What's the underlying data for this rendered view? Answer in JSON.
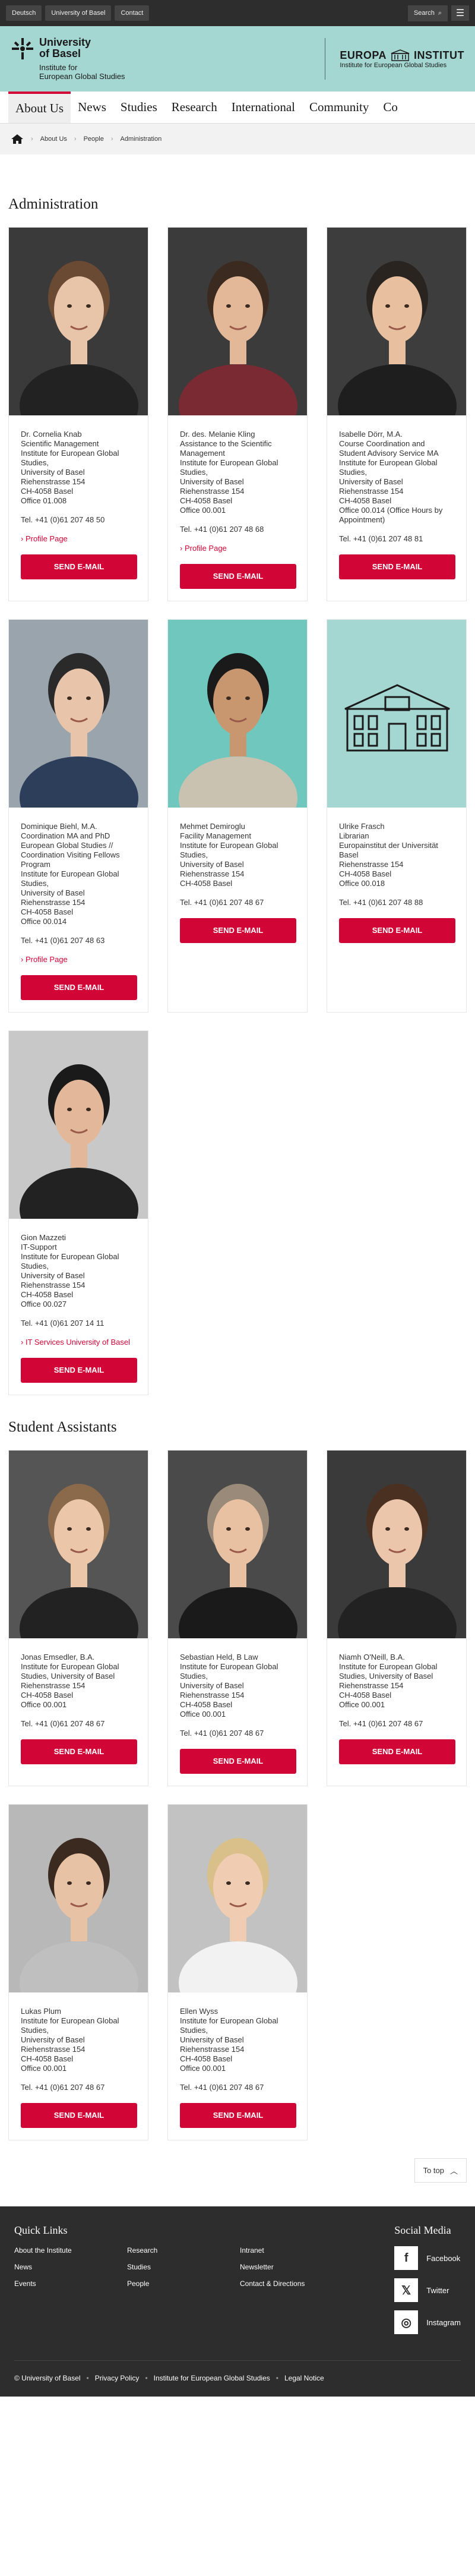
{
  "topbar": {
    "lang1": "Deutsch",
    "lang2": "University of Basel",
    "lang3": "Contact",
    "search": "Search"
  },
  "brand": {
    "uni_name_1": "University",
    "uni_name_2": "of Basel",
    "institute_1": "Institute for",
    "institute_2": "European Global Studies",
    "europa": "EUROPA",
    "institut": "INSTITUT",
    "europa_sub": "Institute for European Global Studies"
  },
  "nav": {
    "items": [
      "About Us",
      "News",
      "Studies",
      "Research",
      "International",
      "Community",
      "Co"
    ]
  },
  "breadcrumb": {
    "items": [
      "About Us",
      "People",
      "Administration"
    ]
  },
  "page_title": "Administration",
  "section_title": "Student Assistants",
  "send_label": "SEND E-MAIL",
  "administration": [
    {
      "lines": [
        "Dr. Cornelia Knab",
        "Scientific Management",
        "Institute for European Global",
        "Studies,",
        "University of Basel",
        "Riehenstrasse 154",
        "CH-4058 Basel",
        "Office 01.008"
      ],
      "tel": "Tel. +41 (0)61 207 48 50",
      "link": "Profile Page"
    },
    {
      "lines": [
        "Dr. des. Melanie Kling",
        "Assistance to the Scientific",
        "Management",
        "Institute for European Global",
        "Studies,",
        "University of Basel",
        "Riehenstrasse 154",
        "CH-4058 Basel",
        "Office 00.001"
      ],
      "tel": "Tel. +41 (0)61 207 48 68",
      "link": "Profile Page"
    },
    {
      "lines": [
        "Isabelle Dörr, M.A.",
        "Course Coordination and",
        "Student Advisory Service MA",
        "Institute for European Global",
        "Studies,",
        "University of Basel",
        "Riehenstrasse 154",
        "CH-4058 Basel",
        "Office 00.014 (Office Hours by",
        "Appointment)"
      ],
      "tel": "Tel. +41 (0)61 207 48 81",
      "link": ""
    },
    {
      "lines": [
        "Dominique Biehl, M.A.",
        "Coordination MA and PhD",
        "European Global Studies //",
        "Coordination Visiting Fellows",
        "Program",
        "Institute for European Global",
        "Studies,",
        "University of Basel",
        "Riehenstrasse 154",
        "CH-4058 Basel",
        "Office 00.014"
      ],
      "tel": "Tel. +41 (0)61 207 48 63",
      "link": "Profile Page"
    },
    {
      "lines": [
        "Mehmet Demiroglu",
        "Facility Management",
        "Institute for European Global",
        "Studies,",
        "University of Basel",
        "Riehenstrasse 154",
        "CH-4058 Basel"
      ],
      "tel": "Tel. +41 (0)61 207 48 67",
      "link": ""
    },
    {
      "lines": [
        "Ulrike Frasch",
        "Librarian",
        "Europainstitut der Universität",
        "Basel",
        "Riehenstrasse 154",
        "CH-4058 Basel",
        "Office 00.018"
      ],
      "tel": "Tel. +41 (0)61 207 48 88",
      "link": ""
    },
    {
      "lines": [
        "Gion Mazzeti",
        "IT-Support",
        "Institute for European Global",
        "Studies,",
        "University of Basel",
        "Riehenstrasse 154",
        "CH-4058 Basel",
        "Office 00.027"
      ],
      "tel": "Tel. +41 (0)61 207 14 11",
      "link": "IT Services University of Basel"
    }
  ],
  "assistants": [
    {
      "lines": [
        "Jonas Emsedler, B.A.",
        "Institute for European Global",
        "Studies, University of Basel",
        "Riehenstrasse 154",
        "CH-4058 Basel",
        "Office 00.001"
      ],
      "tel": "Tel. +41 (0)61 207 48 67"
    },
    {
      "lines": [
        "Sebastian Held, B Law",
        "Institute for European Global",
        "Studies,",
        "University of Basel",
        "Riehenstrasse 154",
        "CH-4058 Basel",
        "Office 00.001"
      ],
      "tel": "Tel. +41 (0)61 207 48 67"
    },
    {
      "lines": [
        "Niamh O'Neill, B.A.",
        "Institute for European Global",
        "Studies, University of Basel",
        "Riehenstrasse 154",
        "CH-4058 Basel",
        "Office 00.001"
      ],
      "tel": "Tel. +41 (0)61 207 48 67"
    },
    {
      "lines": [
        "Lukas Plum",
        "Institute for European Global",
        "Studies,",
        "University of Basel",
        "Riehenstrasse 154",
        "CH-4058 Basel",
        "Office 00.001"
      ],
      "tel": "Tel. +41 (0)61 207 48 67"
    },
    {
      "lines": [
        "Ellen Wyss",
        "Institute for European Global",
        "Studies,",
        "University of Basel",
        "Riehenstrasse 154",
        "CH-4058 Basel",
        "Office 00.001"
      ],
      "tel": "Tel. +41 (0)61 207 48 67"
    }
  ],
  "totop": "To top",
  "footer": {
    "quick_links_title": "Quick Links",
    "quick_links": [
      "About the Institute",
      "Research",
      "Intranet",
      "News",
      "Studies",
      "Newsletter",
      "Events",
      "People",
      "Contact & Directions"
    ],
    "social_title": "Social Media",
    "social": [
      "Facebook",
      "Twitter",
      "Instagram"
    ],
    "bottom": [
      "© University of Basel",
      "Privacy Policy",
      "Institute for European Global Studies",
      "Legal Notice"
    ]
  },
  "colors": {
    "accent": "#d20537",
    "brand_bg": "#a5d7d2",
    "dark": "#2d2d2d"
  }
}
